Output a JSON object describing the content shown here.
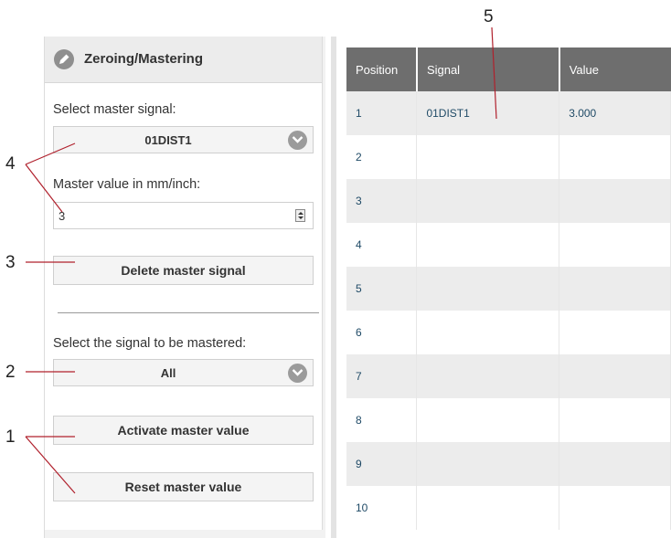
{
  "panel": {
    "title": "Zeroing/Mastering",
    "master_signal_label": "Select master signal:",
    "master_signal_value": "01DIST1",
    "master_value_label": "Master value in mm/inch:",
    "master_value": "3",
    "delete_button": "Delete master signal",
    "signal_to_master_label": "Select the signal to be mastered:",
    "signal_to_master_value": "All",
    "activate_button": "Activate master value",
    "reset_button": "Reset master value"
  },
  "table": {
    "headers": [
      "Position",
      "Signal",
      "Value"
    ],
    "rows": [
      {
        "position": "1",
        "signal": "01DIST1",
        "value": "3.000"
      },
      {
        "position": "2",
        "signal": "",
        "value": ""
      },
      {
        "position": "3",
        "signal": "",
        "value": ""
      },
      {
        "position": "4",
        "signal": "",
        "value": ""
      },
      {
        "position": "5",
        "signal": "",
        "value": ""
      },
      {
        "position": "6",
        "signal": "",
        "value": ""
      },
      {
        "position": "7",
        "signal": "",
        "value": ""
      },
      {
        "position": "8",
        "signal": "",
        "value": ""
      },
      {
        "position": "9",
        "signal": "",
        "value": ""
      },
      {
        "position": "10",
        "signal": "",
        "value": ""
      }
    ]
  },
  "callouts": [
    "1",
    "2",
    "3",
    "4",
    "5"
  ],
  "colors": {
    "header_bg": "#6e6e6e",
    "row_alt": "#ececec",
    "text_link": "#1f4a66",
    "callout_line": "#b0202c"
  }
}
